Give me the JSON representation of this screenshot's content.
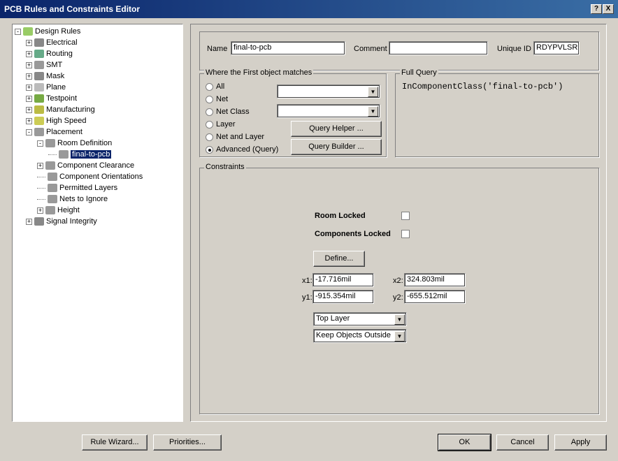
{
  "window": {
    "title": "PCB Rules and Constraints Editor",
    "help": "?",
    "close": "X"
  },
  "tree": [
    {
      "label": "Design Rules",
      "level": 0,
      "exp": "-"
    },
    {
      "label": "Electrical",
      "level": 1,
      "exp": "+"
    },
    {
      "label": "Routing",
      "level": 1,
      "exp": "+"
    },
    {
      "label": "SMT",
      "level": 1,
      "exp": "+"
    },
    {
      "label": "Mask",
      "level": 1,
      "exp": "+"
    },
    {
      "label": "Plane",
      "level": 1,
      "exp": "+"
    },
    {
      "label": "Testpoint",
      "level": 1,
      "exp": "+"
    },
    {
      "label": "Manufacturing",
      "level": 1,
      "exp": "+"
    },
    {
      "label": "High Speed",
      "level": 1,
      "exp": "+"
    },
    {
      "label": "Placement",
      "level": 1,
      "exp": "-"
    },
    {
      "label": "Room Definition",
      "level": 2,
      "exp": "-"
    },
    {
      "label": "final-to-pcb",
      "level": 3,
      "exp": "",
      "selected": true
    },
    {
      "label": "Component Clearance",
      "level": 2,
      "exp": "+"
    },
    {
      "label": "Component Orientations",
      "level": 2,
      "exp": ""
    },
    {
      "label": "Permitted Layers",
      "level": 2,
      "exp": ""
    },
    {
      "label": "Nets to Ignore",
      "level": 2,
      "exp": ""
    },
    {
      "label": "Height",
      "level": 2,
      "exp": "+"
    },
    {
      "label": "Signal Integrity",
      "level": 1,
      "exp": "+"
    }
  ],
  "header": {
    "name_label": "Name",
    "name_value": "final-to-pcb",
    "comment_label": "Comment",
    "comment_value": "",
    "uid_label": "Unique ID",
    "uid_value": "RDYPVLSR"
  },
  "match": {
    "title": "Where the First object matches",
    "options": [
      "All",
      "Net",
      "Net Class",
      "Layer",
      "Net and Layer",
      "Advanced (Query)"
    ],
    "selected": 5,
    "query_helper": "Query Helper ...",
    "query_builder": "Query Builder ..."
  },
  "full_query": {
    "title": "Full Query",
    "text": "InComponentClass('final-to-pcb')"
  },
  "constraints": {
    "title": "Constraints",
    "room_locked": "Room Locked",
    "components_locked": "Components Locked",
    "define": "Define...",
    "x1_label": "x1:",
    "x1": "-17.716mil",
    "x2_label": "x2:",
    "x2": "324.803mil",
    "y1_label": "y1:",
    "y1": "-915.354mil",
    "y2_label": "y2:",
    "y2": "-655.512mil",
    "layer": "Top Layer",
    "keep": "Keep Objects Outside"
  },
  "footer": {
    "rule_wizard": "Rule Wizard...",
    "priorities": "Priorities...",
    "ok": "OK",
    "cancel": "Cancel",
    "apply": "Apply"
  }
}
